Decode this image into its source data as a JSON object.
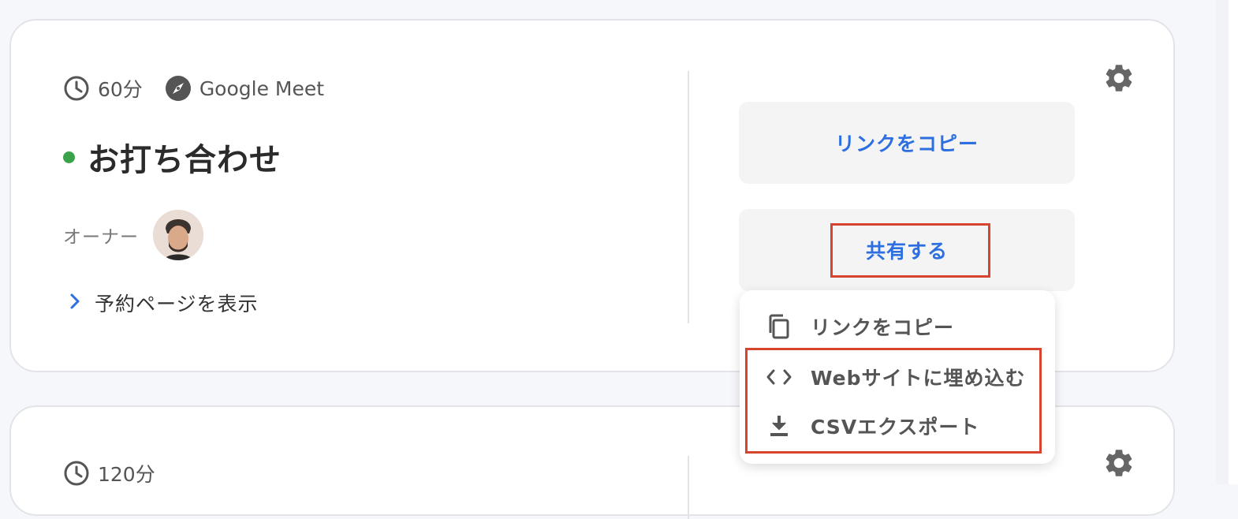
{
  "cards": [
    {
      "duration": "60分",
      "location": "Google Meet",
      "title": "お打ち合わせ",
      "status_color": "#3aa34a",
      "owner_label": "オーナー",
      "view_link": "予約ページを表示",
      "copy_link_button": "リンクをコピー",
      "share_button": "共有する"
    },
    {
      "duration": "120分"
    }
  ],
  "share_menu": {
    "items": [
      {
        "label": "リンクをコピー",
        "icon": "copy-icon"
      },
      {
        "label": "Webサイトに埋め込む",
        "icon": "code-icon"
      },
      {
        "label": "CSVエクスポート",
        "icon": "download-icon"
      }
    ]
  },
  "colors": {
    "accent": "#2d6fe0",
    "highlight": "#d6432f"
  }
}
